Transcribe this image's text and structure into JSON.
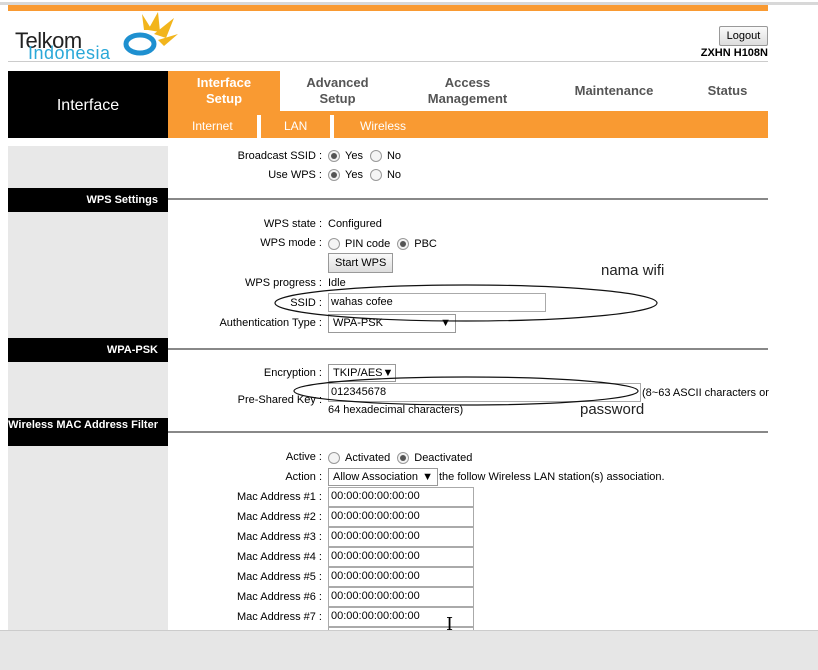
{
  "header": {
    "logo_line1": "Telkom",
    "logo_line2": "Indonesia",
    "logout": "Logout",
    "model": "ZXHN H108N"
  },
  "nav": {
    "section": "Interface",
    "tabs": [
      {
        "label": "Interface Setup"
      },
      {
        "label": "Advanced Setup"
      },
      {
        "label": "Access Management"
      },
      {
        "label": "Maintenance"
      },
      {
        "label": "Status"
      }
    ],
    "subtabs": [
      "Internet",
      "LAN",
      "Wireless"
    ]
  },
  "broadcast": {
    "label": "Broadcast SSID :",
    "yes": "Yes",
    "no": "No"
  },
  "usewps": {
    "label": "Use WPS :",
    "yes": "Yes",
    "no": "No"
  },
  "wps": {
    "header": "WPS Settings",
    "state_label": "WPS state :",
    "state": "Configured",
    "mode_label": "WPS mode :",
    "pin": "PIN code",
    "pbc": "PBC",
    "start": "Start WPS",
    "progress_label": "WPS progress :",
    "progress": "Idle",
    "ssid_label": "SSID :",
    "ssid": "wahas cofee",
    "auth_label": "Authentication Type :",
    "auth": "WPA-PSK"
  },
  "wpa": {
    "header": "WPA-PSK",
    "enc_label": "Encryption :",
    "enc": "TKIP/AES",
    "psk_label": "Pre-Shared Key :",
    "psk": "012345678",
    "hint1": "(8~63 ASCII characters or",
    "hint2": "64 hexadecimal characters)"
  },
  "mac": {
    "header": "Wireless MAC Address Filter",
    "active_label": "Active :",
    "activated": "Activated",
    "deactivated": "Deactivated",
    "action_label": "Action :",
    "action": "Allow Association",
    "action_suffix": "the follow Wireless LAN station(s) association.",
    "entries": [
      {
        "label": "Mac Address #1 :",
        "value": "00:00:00:00:00:00"
      },
      {
        "label": "Mac Address #2 :",
        "value": "00:00:00:00:00:00"
      },
      {
        "label": "Mac Address #3 :",
        "value": "00:00:00:00:00:00"
      },
      {
        "label": "Mac Address #4 :",
        "value": "00:00:00:00:00:00"
      },
      {
        "label": "Mac Address #5 :",
        "value": "00:00:00:00:00:00"
      },
      {
        "label": "Mac Address #6 :",
        "value": "00:00:00:00:00:00"
      },
      {
        "label": "Mac Address #7 :",
        "value": "00:00:00:00:00:00"
      }
    ]
  },
  "annotations": {
    "ssid_note": "nama wifi",
    "psk_note": "password"
  }
}
